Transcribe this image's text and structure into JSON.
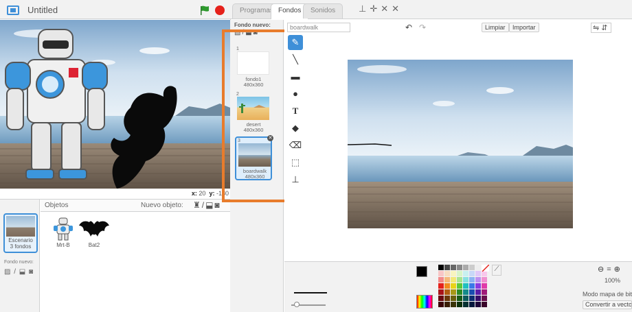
{
  "project": {
    "title": "Untitled"
  },
  "stage": {
    "coord_x_label": "x:",
    "coord_x": "20",
    "coord_y_label": "y:",
    "coord_y": "-180"
  },
  "sprites_pane": {
    "objects_label": "Objetos",
    "new_object_label": "Nuevo objeto:",
    "scene": {
      "name": "Escenario",
      "count": "3 fondos"
    },
    "scene_new_label": "Fondo nuevo:",
    "sprites": [
      {
        "name": "Mrt-B"
      },
      {
        "name": "Bat2"
      }
    ]
  },
  "tabs": [
    {
      "label": "Programas"
    },
    {
      "label": "Fondos"
    },
    {
      "label": "Sonidos"
    }
  ],
  "backdrops_pane": {
    "new_label": "Fondo nuevo:",
    "items": [
      {
        "num": "1",
        "name": "fondo1",
        "size": "480x360"
      },
      {
        "num": "2",
        "name": "desert",
        "size": "480x360"
      },
      {
        "num": "3",
        "name": "boardwalk",
        "size": "480x360"
      }
    ]
  },
  "editor": {
    "costume_name": "boardwalk",
    "clear_label": "Limpiar",
    "import_label": "Importar",
    "zoom": "100%",
    "mode_label": "Modo mapa de bits",
    "convert_label": "Convertir a vector"
  },
  "colors": {
    "accent": "#3e8fd8",
    "highlight": "#e87c2c",
    "stop": "#e5211b",
    "flag": "#2e9a2e"
  },
  "icons": [
    "fullscreen-icon",
    "green-flag-icon",
    "stop-icon",
    "brush-icon",
    "line-icon",
    "rectangle-icon",
    "ellipse-icon",
    "text-icon",
    "fill-icon",
    "eraser-icon",
    "select-icon",
    "stamp-icon",
    "undo-icon",
    "redo-icon",
    "zoom-in-icon",
    "zoom-out-icon",
    "eyedropper-icon"
  ]
}
